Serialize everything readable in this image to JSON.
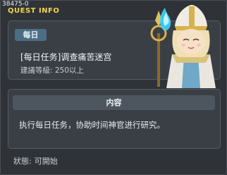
{
  "window": {
    "id_tag": "38475-0",
    "title": "QUEST INFO"
  },
  "quest": {
    "category_badge": "每日",
    "name": "[每日任务]调查痛苦迷宫",
    "requirement": "建議等級: 250以上"
  },
  "content": {
    "header": "内容",
    "description": "执行每日任务，协助时间神官进行研究。"
  },
  "status": {
    "label": "狀態:",
    "value": "可開始"
  },
  "colors": {
    "title": "#f4d34a",
    "badge": "#4c6e84",
    "panel": "#3a3f45",
    "background": "#2f3338"
  },
  "npc": {
    "icon": "priest-npc-with-blue-flame-staff"
  }
}
